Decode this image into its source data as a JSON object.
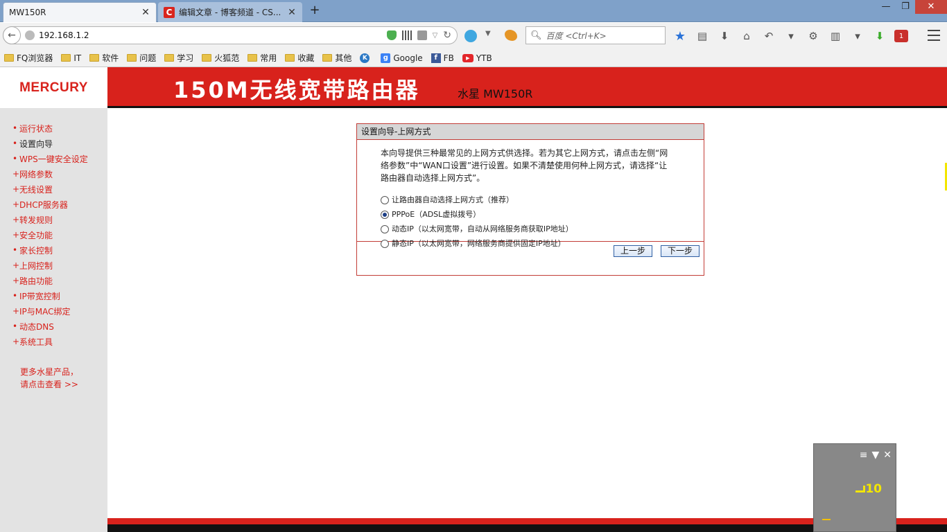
{
  "browser": {
    "tabs": [
      {
        "title": "MW150R",
        "active": true
      },
      {
        "title": "编辑文章 - 博客频道 - CS...",
        "active": false,
        "icon": "C"
      }
    ],
    "url": "192.168.1.2",
    "search_placeholder": "百度 <Ctrl+K>",
    "window_buttons": {
      "minimize": "—",
      "restore": "❐",
      "close": "✕"
    },
    "bookmarks": [
      {
        "label": "FQ浏览器",
        "icon": "folder"
      },
      {
        "label": "IT",
        "icon": "folder"
      },
      {
        "label": "软件",
        "icon": "folder"
      },
      {
        "label": "问题",
        "icon": "folder"
      },
      {
        "label": "学习",
        "icon": "folder"
      },
      {
        "label": "火狐范",
        "icon": "folder"
      },
      {
        "label": "常用",
        "icon": "folder"
      },
      {
        "label": "收藏",
        "icon": "folder"
      },
      {
        "label": "其他",
        "icon": "folder"
      },
      {
        "label": "",
        "icon": "k"
      },
      {
        "label": "Google",
        "icon": "google"
      },
      {
        "label": "FB",
        "icon": "facebook"
      },
      {
        "label": "YTB",
        "icon": "youtube"
      }
    ],
    "extension_badge": "1"
  },
  "router": {
    "logo": "MERCURY",
    "title": "150M无线宽带路由器",
    "model": "水星 MW150R",
    "menu": [
      {
        "label": "运行状态",
        "bullet": "•",
        "style": "red"
      },
      {
        "label": "设置向导",
        "bullet": "•",
        "style": "dark"
      },
      {
        "label": "WPS一键安全设定",
        "bullet": "•",
        "style": "red"
      },
      {
        "label": "网络参数",
        "bullet": "+",
        "style": "red"
      },
      {
        "label": "无线设置",
        "bullet": "+",
        "style": "red"
      },
      {
        "label": "DHCP服务器",
        "bullet": "+",
        "style": "red"
      },
      {
        "label": "转发规则",
        "bullet": "+",
        "style": "red"
      },
      {
        "label": "安全功能",
        "bullet": "+",
        "style": "red"
      },
      {
        "label": "家长控制",
        "bullet": "•",
        "style": "red"
      },
      {
        "label": "上网控制",
        "bullet": "+",
        "style": "red"
      },
      {
        "label": "路由功能",
        "bullet": "+",
        "style": "red"
      },
      {
        "label": "IP带宽控制",
        "bullet": "•",
        "style": "red"
      },
      {
        "label": "IP与MAC绑定",
        "bullet": "+",
        "style": "red"
      },
      {
        "label": "动态DNS",
        "bullet": "•",
        "style": "red"
      },
      {
        "label": "系统工具",
        "bullet": "+",
        "style": "red"
      }
    ],
    "promo_line1": "更多水星产品，",
    "promo_line2": "请点击查看 >>",
    "wizard": {
      "title": "设置向导-上网方式",
      "description_line1": "本向导提供三种最常见的上网方式供选择。若为其它上网方式，请点击左侧“网",
      "description_line2": "络参数”中“WAN口设置”进行设置。如果不清楚使用何种上网方式，请选择“让",
      "description_line3": "路由器自动选择上网方式”。",
      "options": [
        {
          "label": "让路由器自动选择上网方式（推荐）",
          "selected": false
        },
        {
          "label": "PPPoE（ADSL虚拟拨号）",
          "selected": true
        },
        {
          "label": "动态IP（以太网宽带，自动从网络服务商获取IP地址）",
          "selected": false
        },
        {
          "label": "静态IP（以太网宽带，网络服务商提供固定IP地址）",
          "selected": false
        }
      ],
      "prev_button": "上一步",
      "next_button": "下一步"
    }
  },
  "widget": {
    "value": "10"
  },
  "colors": {
    "brand_red": "#d8221c",
    "tabbar": "#7fa1c9"
  }
}
